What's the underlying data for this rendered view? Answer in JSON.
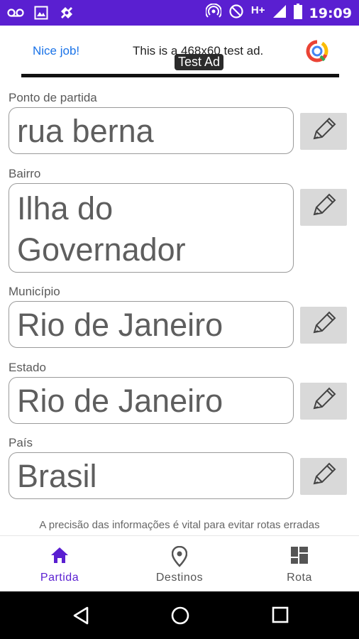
{
  "status_bar": {
    "time": "19:09",
    "network": "H+",
    "icons_left": [
      "voicemail-icon",
      "image-icon",
      "puzzle-icon"
    ],
    "icons_right": [
      "hotspot-icon",
      "dnd-icon",
      "signal-icon",
      "battery-icon"
    ]
  },
  "ad": {
    "label_left": "Nice job!",
    "text": "This is a 468x60 test ad.",
    "tag": "Test Ad"
  },
  "form": {
    "fields": [
      {
        "label": "Ponto de partida",
        "value": "rua berna"
      },
      {
        "label": "Bairro",
        "value": "Ilha do Governador"
      },
      {
        "label": "Município",
        "value": "Rio de Janeiro"
      },
      {
        "label": "Estado",
        "value": "Rio de Janeiro"
      },
      {
        "label": "País",
        "value": "Brasil"
      }
    ],
    "note": "A precisão das informações é vital para evitar rotas erradas"
  },
  "bottom_nav": {
    "items": [
      {
        "label": "Partida",
        "icon": "home-icon",
        "active": true
      },
      {
        "label": "Destinos",
        "icon": "location-pin-icon",
        "active": false
      },
      {
        "label": "Rota",
        "icon": "dashboard-icon",
        "active": false
      }
    ],
    "active_color": "#5a1fd1"
  },
  "colors": {
    "status_bar": "#5a1fd1",
    "accent": "#5a1fd1",
    "edit_button": "#d9d9d9"
  }
}
